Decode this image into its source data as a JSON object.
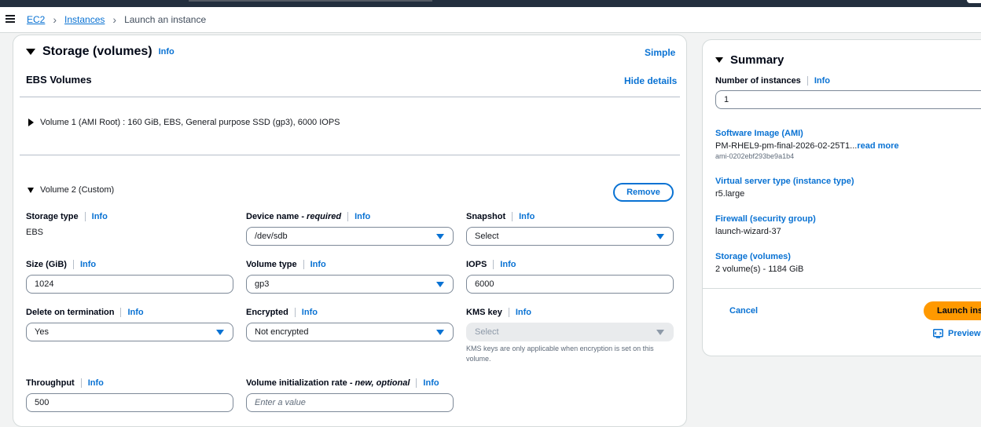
{
  "breadcrumb": {
    "items": [
      "EC2",
      "Instances"
    ],
    "current": "Launch an instance"
  },
  "storage": {
    "title": "Storage (volumes)",
    "info": "Info",
    "simple_link": "Simple",
    "ebs_title": "EBS Volumes",
    "hide_details": "Hide details",
    "volume1_summary": "Volume 1 (AMI Root) : 160 GiB, EBS, General purpose SSD (gp3), 6000 IOPS",
    "volume2_title": "Volume 2 (Custom)",
    "remove_label": "Remove",
    "fields": {
      "storage_type": {
        "label": "Storage type",
        "value": "EBS"
      },
      "device_name": {
        "label": "Device name - ",
        "label_em": "required",
        "value": "/dev/sdb"
      },
      "snapshot": {
        "label": "Snapshot",
        "value": "Select"
      },
      "size": {
        "label": "Size (GiB)",
        "value": "1024"
      },
      "volume_type": {
        "label": "Volume type",
        "value": "gp3"
      },
      "iops": {
        "label": "IOPS",
        "value": "6000"
      },
      "delete_on_termination": {
        "label": "Delete on termination",
        "value": "Yes"
      },
      "encrypted": {
        "label": "Encrypted",
        "value": "Not encrypted"
      },
      "kms_key": {
        "label": "KMS key",
        "value": "Select",
        "hint": "KMS keys are only applicable when encryption is set on this volume."
      },
      "throughput": {
        "label": "Throughput",
        "value": "500"
      },
      "init_rate": {
        "label": "Volume initialization rate - ",
        "label_em": "new, optional",
        "placeholder": "Enter a value"
      }
    }
  },
  "summary": {
    "title": "Summary",
    "instances_label": "Number of instances",
    "instances_info": "Info",
    "instances_value": "1",
    "ami_title": "Software Image (AMI)",
    "ami_value": "PM-RHEL9-pm-final-2026-02-25T1...",
    "ami_read_more": "read more",
    "ami_id": "ami-0202ebf293be9a1b4",
    "instance_type_title": "Virtual server type (instance type)",
    "instance_type_value": "r5.large",
    "firewall_title": "Firewall (security group)",
    "firewall_value": "launch-wizard-37",
    "storage_title": "Storage (volumes)",
    "storage_value": "2 volume(s) - 1184 GiB",
    "cancel_label": "Cancel",
    "launch_label": "Launch instance",
    "preview_label": "Preview code"
  },
  "colors": {
    "link": "#0972d3",
    "launch": "#ff9900",
    "topbar": "#232f3e"
  },
  "icons": [
    "menu-icon",
    "chevron-right-icon",
    "caret-down-icon",
    "caret-right-icon",
    "code-preview-icon"
  ]
}
